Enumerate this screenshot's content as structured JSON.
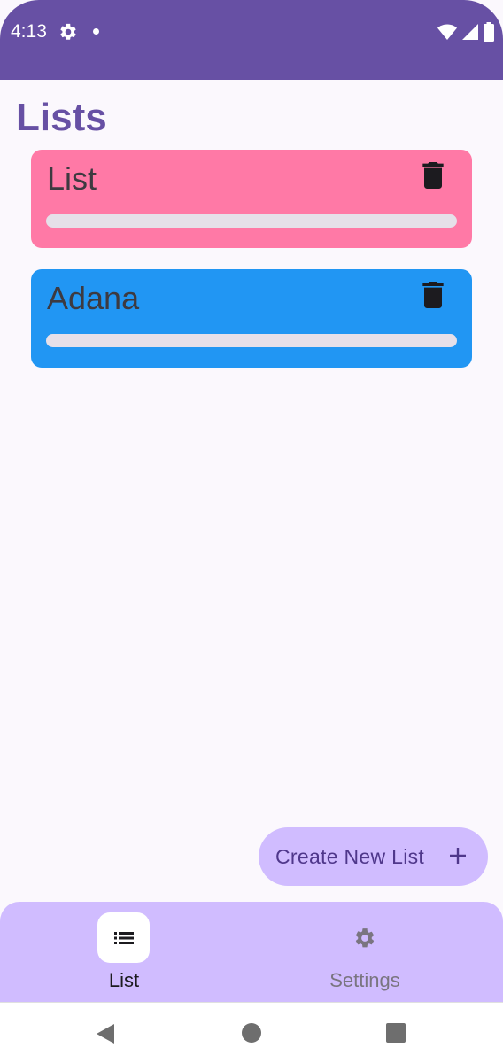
{
  "status_bar": {
    "time": "4:13",
    "icons": [
      "gear-icon",
      "notification-dot-icon",
      "wifi-icon",
      "cellular-signal-icon",
      "battery-icon"
    ],
    "background_color": "#6750a4"
  },
  "page": {
    "title": "Lists",
    "title_color": "#6750a4"
  },
  "lists": [
    {
      "title": "List",
      "color": "#ff79a6",
      "progress": 0,
      "icon": "trash-icon"
    },
    {
      "title": "Adana",
      "color": "#2196f3",
      "progress": 0,
      "icon": "trash-icon"
    }
  ],
  "fab": {
    "label": "Create New List",
    "icon": "plus-icon",
    "color": "#d0bcff"
  },
  "bottom_nav": {
    "items": [
      {
        "label": "List",
        "icon": "list-icon",
        "selected": true
      },
      {
        "label": "Settings",
        "icon": "settings-gear-icon",
        "selected": false
      }
    ],
    "background_color": "#d0bcff"
  },
  "system_nav": {
    "buttons": [
      "back-icon",
      "home-icon",
      "recents-icon"
    ]
  }
}
